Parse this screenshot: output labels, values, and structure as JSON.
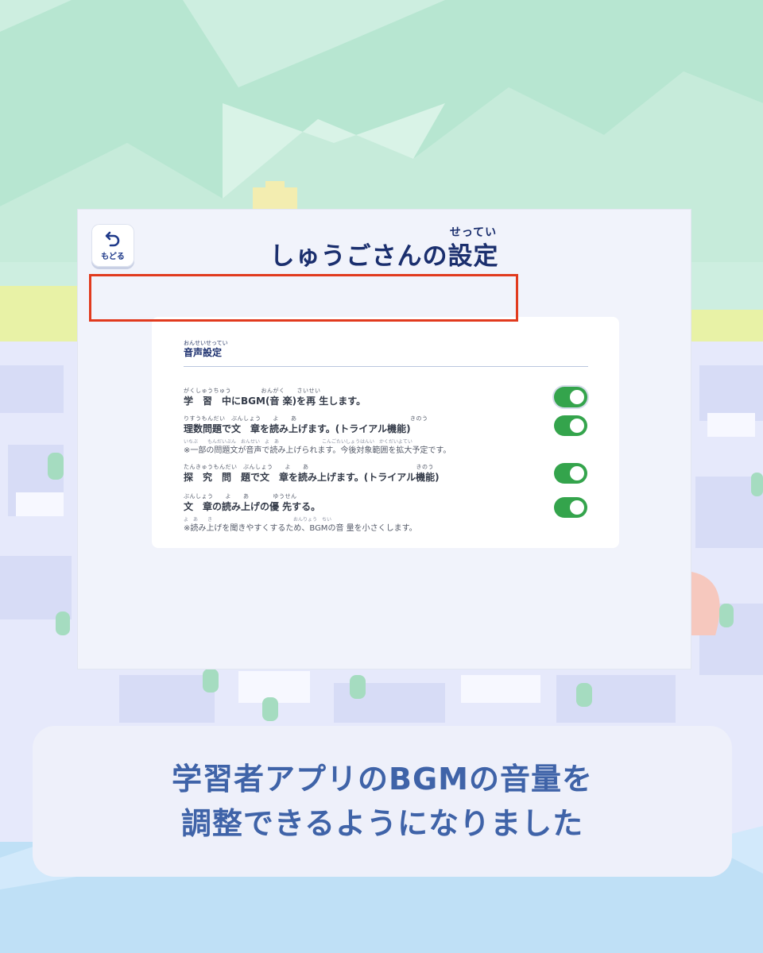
{
  "background": {
    "sky_color": "#cdeee0",
    "mountain_color": "#b7e6d1",
    "water_color": "#bfe0f6",
    "city_color": "#e6e9fb"
  },
  "panel": {
    "back_button": {
      "icon": "undo-arrow-icon",
      "label": "もどる"
    },
    "title": {
      "main": "しゅうごさんの",
      "kanji": "設定",
      "ruby": "せってい"
    },
    "section": {
      "ruby": "おんせいせってい",
      "title": "音声設定",
      "rows": [
        {
          "ruby": "がくしゅうちゅう　　　　　おんがく　　さいせい",
          "label": "学　習　中にBGM(音 楽)を再 生します。",
          "enabled": true
        },
        {
          "ruby": "りすうもんだい　ぶんしょう　　よ　　あ　　　　　　　　　　　　　　　　　　　きのう",
          "label": "理数問題で文　章を読み上げます。(トライアル機能)",
          "note_ruby": "いちぶ　　もんだいぶん　おんせい　よ　あ　　　　　　　　　こんごたいしょうはんい　かくだいよてい",
          "note": "※一部の問題文が音声で読み上げられます。今後対象範囲を拡大予定です。",
          "enabled": true
        },
        {
          "ruby": "たんきゅうもんだい　ぶんしょう　　よ　　あ　　　　　　　　　　　　　　　　　　きのう",
          "label": "探　究　問　題で文　章を読み上げます。(トライアル機能)",
          "enabled": true
        },
        {
          "ruby": "ぶんしょう　　よ　　あ　　　　ゆうせん",
          "label": "文　章の読み上げの優 先する。",
          "note_ruby": "よ　あ　　き　　　　　　　　　　　　　　　　　おんりょう　ちい",
          "note": "※読み上げを聞きやすくするため、BGMの音 量を小さくします。",
          "enabled": true
        }
      ]
    },
    "highlight_color": "#e13a1e",
    "toggle_color": "#34a44c"
  },
  "caption": {
    "line1": "学習者アプリのBGMの音量を",
    "line2": "調整できるようになりました"
  }
}
